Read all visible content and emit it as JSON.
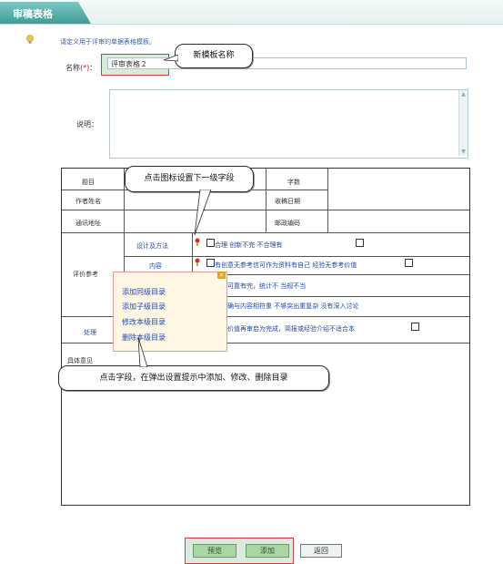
{
  "header": {
    "title": "审稿表格"
  },
  "hint": {
    "text": "请定义用于评审的单据表格模板。"
  },
  "name_field": {
    "label": "名称",
    "required_mark": "(*)",
    "colon": "：",
    "value": "评审表格２"
  },
  "desc_field": {
    "label": "说明："
  },
  "callouts": {
    "new_template_name": "新模板名称",
    "set_next_level": "点击图标设置下一级字段",
    "click_field": "点击字段，在弹出设置提示中添加、修改、删除目录"
  },
  "form_table": {
    "rows": {
      "title": "题目",
      "word_count": "字数",
      "author_name": "作者姓名",
      "received_date": "收稿日期",
      "address": "通讯地址",
      "postcode": "邮政编码",
      "evaluation": "评价参考",
      "processing": "处理",
      "specific_opinion": "具体意见"
    },
    "subfields": {
      "design_method": "设计及方法",
      "content": "内容"
    },
    "option_lines": [
      "合理    创新不完    不合理有",
      "有创意无参考信可作为资料有自己    经验无参考价值",
      "结构可靠有完，统计不    当规不当",
      "点明确与内容相符重    不够突出重复杂    没有深入讨论",
      "利用价值再审启为完成，简报或经验介绍不适合本"
    ]
  },
  "context_menu": {
    "items": [
      "添加同级目录",
      "添加子级目录",
      "修改本级目录",
      "删除本级目录"
    ],
    "close_glyph": "×"
  },
  "buttons": {
    "preview": "预览",
    "add": "添加",
    "back": "返回"
  }
}
